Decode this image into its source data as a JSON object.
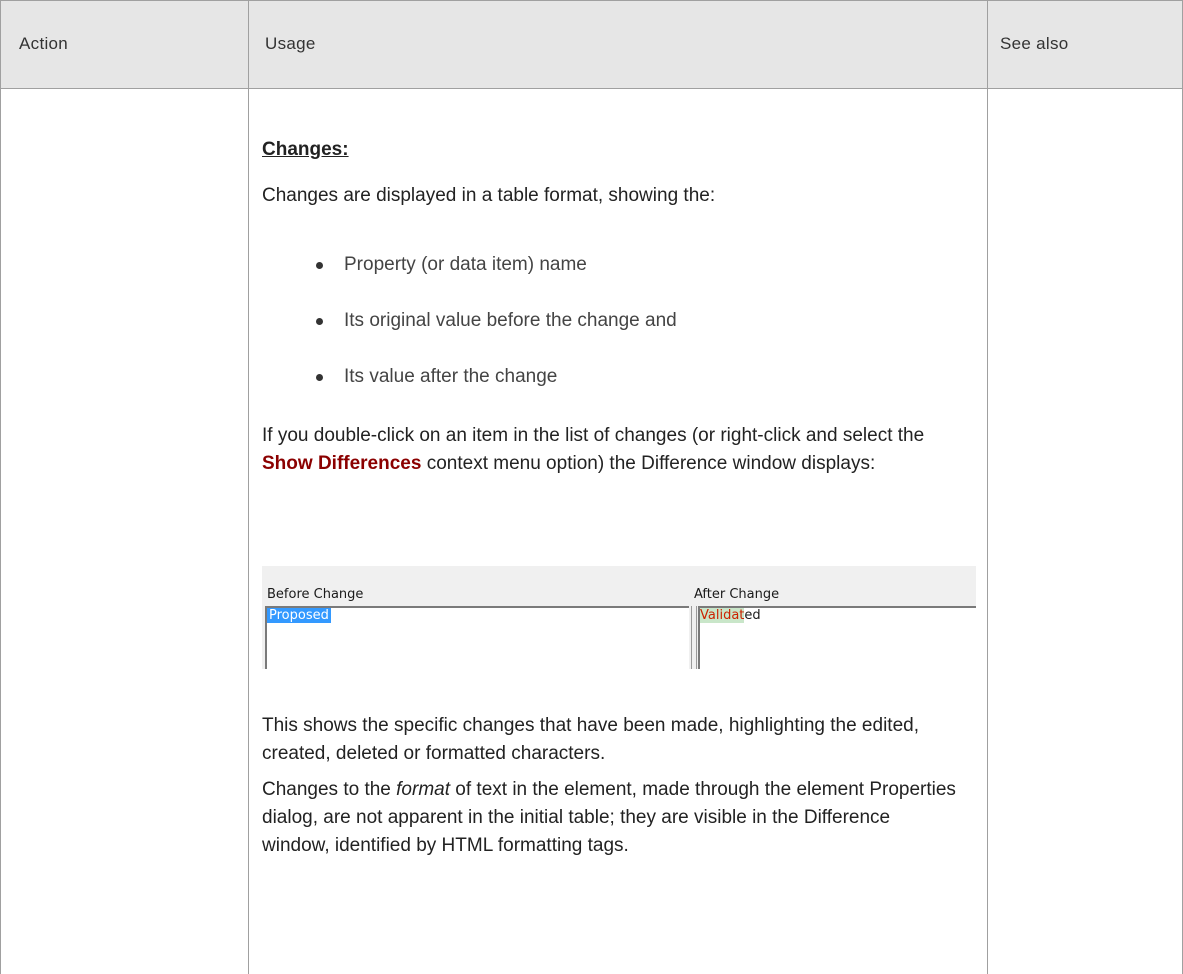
{
  "header": {
    "col_action": "Action",
    "col_usage": "Usage",
    "col_see_also": "See also"
  },
  "usage": {
    "heading": "Changes:",
    "intro": "Changes are displayed in a table format, showing the:",
    "bullets": [
      "Property (or data item) name",
      "Its original value before the change and",
      "Its value after the change"
    ],
    "dblclick_part1": "If you double-click on an item in the list of changes (or right-click and select the ",
    "dblclick_menu": "Show Differences",
    "dblclick_part2": " context menu option) the Difference window displays:",
    "diff_window": {
      "before_label": "Before Change",
      "after_label": "After Change",
      "before_value": "Proposed",
      "after_changed": "Validat",
      "after_rest": "ed"
    },
    "shows_text": "This shows the specific changes that have been made, highlighting the edited, created, deleted or formatted characters.",
    "format_part1": "Changes to the ",
    "format_em": "format",
    "format_part2": " of text in the element, made through the element Properties dialog, are not apparent in the initial table; they are visible in the Difference window, identified by HTML formatting tags."
  },
  "colors": {
    "header_bg": "#e6e6e6",
    "border": "#a0a0a0",
    "menu_ref": "#8b0000",
    "selection": "#3399ff",
    "diff_highlight": "#c9e6c9",
    "diff_text": "#cc2200"
  }
}
